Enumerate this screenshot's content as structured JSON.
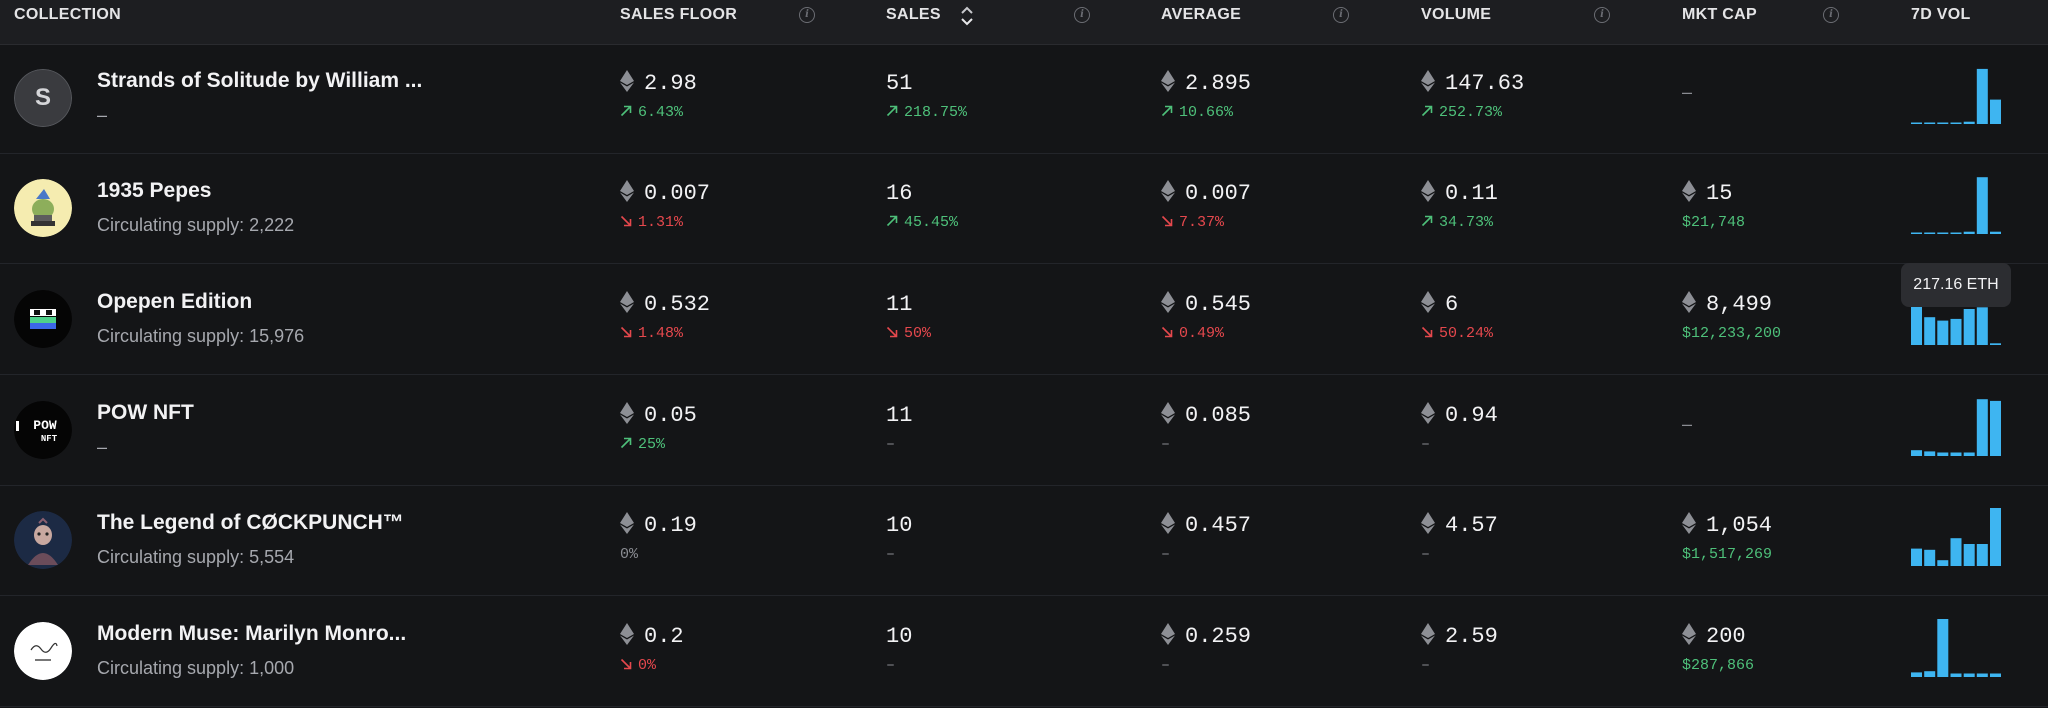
{
  "colors": {
    "accent_bar": "#3eb5f1",
    "up": "#4ec07a",
    "down": "#e5484d",
    "bg": "#141517"
  },
  "headers": {
    "collection": "COLLECTION",
    "sales_floor": "SALES FLOOR",
    "sales": "SALES",
    "average": "AVERAGE",
    "volume": "VOLUME",
    "mkt_cap": "MKT CAP",
    "vol7d": "7D VOL"
  },
  "tooltip": "217.16 ETH",
  "rows": [
    {
      "avatar_letter": "S",
      "name": "Strands of Solitude by William ...",
      "sub": "–",
      "floor": "2.98",
      "floor_chg": "6.43%",
      "floor_dir": "up",
      "sales": "51",
      "sales_chg": "218.75%",
      "sales_dir": "up",
      "avg": "2.895",
      "avg_chg": "10.66%",
      "avg_dir": "up",
      "vol": "147.63",
      "vol_chg": "252.73%",
      "vol_dir": "up",
      "mcap": "–",
      "mcap_usd": "",
      "spark": [
        0.02,
        0.02,
        0.02,
        0.02,
        0.04,
        0.95,
        0.42
      ]
    },
    {
      "avatar_letter": "",
      "name": "1935 Pepes",
      "sub": "Circulating supply: 2,222",
      "floor": "0.007",
      "floor_chg": "1.31%",
      "floor_dir": "down",
      "sales": "16",
      "sales_chg": "45.45%",
      "sales_dir": "up",
      "avg": "0.007",
      "avg_chg": "7.37%",
      "avg_dir": "down",
      "vol": "0.11",
      "vol_chg": "34.73%",
      "vol_dir": "up",
      "mcap": "15",
      "mcap_usd": "$21,748",
      "spark": [
        0.02,
        0.02,
        0.02,
        0.02,
        0.04,
        0.98,
        0.04
      ]
    },
    {
      "avatar_letter": "",
      "name": "Opepen Edition",
      "sub": "Circulating supply: 15,976",
      "floor": "0.532",
      "floor_chg": "1.48%",
      "floor_dir": "down",
      "sales": "11",
      "sales_chg": "50%",
      "sales_dir": "down",
      "avg": "0.545",
      "avg_chg": "0.49%",
      "avg_dir": "down",
      "vol": "6",
      "vol_chg": "50.24%",
      "vol_dir": "down",
      "mcap": "8,499",
      "mcap_usd": "$12,233,200",
      "spark": [
        0.85,
        0.48,
        0.42,
        0.45,
        0.62,
        0.65,
        0.03
      ]
    },
    {
      "avatar_letter": "",
      "name": "POW NFT",
      "sub": "–",
      "floor": "0.05",
      "floor_chg": "25%",
      "floor_dir": "up",
      "sales": "11",
      "sales_chg": "–",
      "sales_dir": "none",
      "avg": "0.085",
      "avg_chg": "–",
      "avg_dir": "none",
      "vol": "0.94",
      "vol_chg": "–",
      "vol_dir": "none",
      "mcap": "–",
      "mcap_usd": "",
      "spark": [
        0.1,
        0.08,
        0.06,
        0.06,
        0.06,
        0.98,
        0.95
      ]
    },
    {
      "avatar_letter": "",
      "name": "The Legend of CØCKPUNCH™",
      "sub": "Circulating supply: 5,554",
      "floor": "0.19",
      "floor_chg": "0%",
      "floor_dir": "neutral",
      "sales": "10",
      "sales_chg": "–",
      "sales_dir": "none",
      "avg": "0.457",
      "avg_chg": "–",
      "avg_dir": "none",
      "vol": "4.57",
      "vol_chg": "–",
      "vol_dir": "none",
      "mcap": "1,054",
      "mcap_usd": "$1,517,269",
      "spark": [
        0.3,
        0.28,
        0.1,
        0.48,
        0.38,
        0.38,
        1.0
      ]
    },
    {
      "avatar_letter": "",
      "name": "Modern Muse: Marilyn Monro...",
      "sub": "Circulating supply: 1,000",
      "floor": "0.2",
      "floor_chg": "0%",
      "floor_dir": "down",
      "sales": "10",
      "sales_chg": "–",
      "sales_dir": "none",
      "avg": "0.259",
      "avg_chg": "–",
      "avg_dir": "none",
      "vol": "2.59",
      "vol_chg": "–",
      "vol_dir": "none",
      "mcap": "200",
      "mcap_usd": "$287,866",
      "spark": [
        0.08,
        0.1,
        1.0,
        0.06,
        0.06,
        0.06,
        0.06
      ]
    }
  ]
}
